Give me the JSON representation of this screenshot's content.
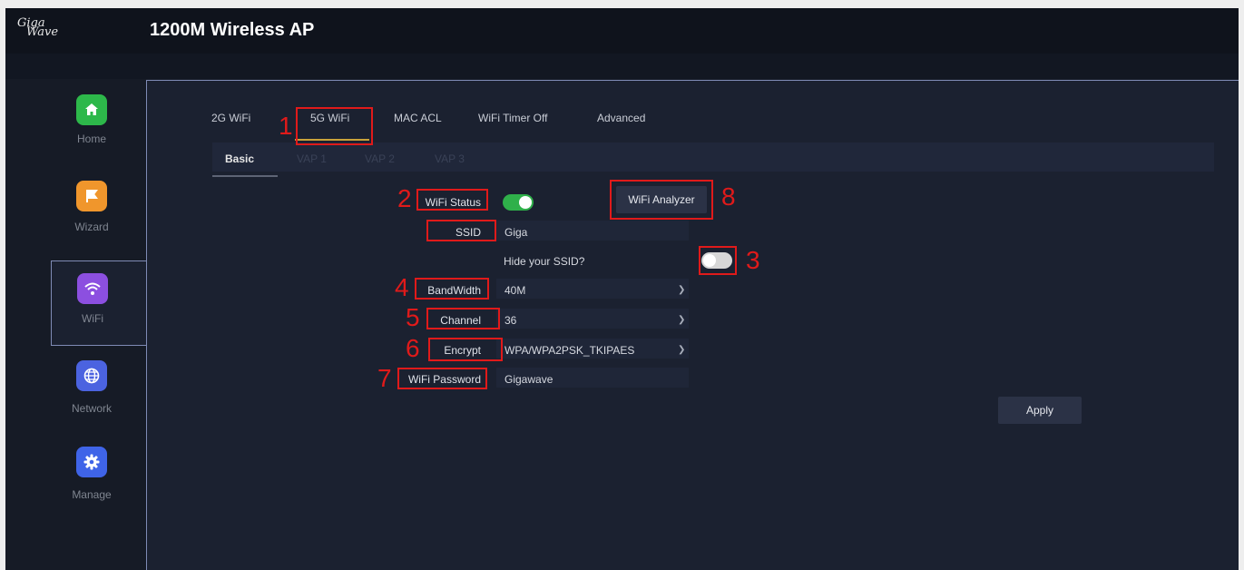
{
  "header": {
    "logo_line1": "Giga",
    "logo_line2": "Wave",
    "title": "1200M Wireless AP"
  },
  "sidebar": {
    "items": [
      {
        "label": "Home",
        "color": "#2db84a"
      },
      {
        "label": "Wizard",
        "color": "#f0962c"
      },
      {
        "label": "WiFi",
        "color": "#8c4fe0"
      },
      {
        "label": "Network",
        "color": "#4b63e0"
      },
      {
        "label": "Manage",
        "color": "#3f64e8"
      }
    ]
  },
  "tabs": [
    "2G WiFi",
    "5G WiFi",
    "MAC ACL",
    "WiFi Timer Off",
    "Advanced"
  ],
  "subtabs": [
    "Basic",
    "VAP 1",
    "VAP 2",
    "VAP 3"
  ],
  "form": {
    "wifi_status_label": "WiFi Status",
    "ssid_label": "SSID",
    "ssid_value": "Giga",
    "hide_ssid_label": "Hide your SSID?",
    "bandwidth_label": "BandWidth",
    "bandwidth_value": "40M",
    "channel_label": "Channel",
    "channel_value": "36",
    "encrypt_label": "Encrypt",
    "encrypt_value": "WPA/WPA2PSK_TKIPAES",
    "password_label": "WiFi Password",
    "password_value": "Gigawave",
    "analyzer_label": "WiFi Analyzer",
    "apply_label": "Apply"
  },
  "annotations": [
    "1",
    "2",
    "3",
    "4",
    "5",
    "6",
    "7",
    "8"
  ],
  "colors": {
    "accent_underline": "#c9a23a",
    "annotation_red": "#e01a1a",
    "toggle_on": "#2fb04a"
  }
}
